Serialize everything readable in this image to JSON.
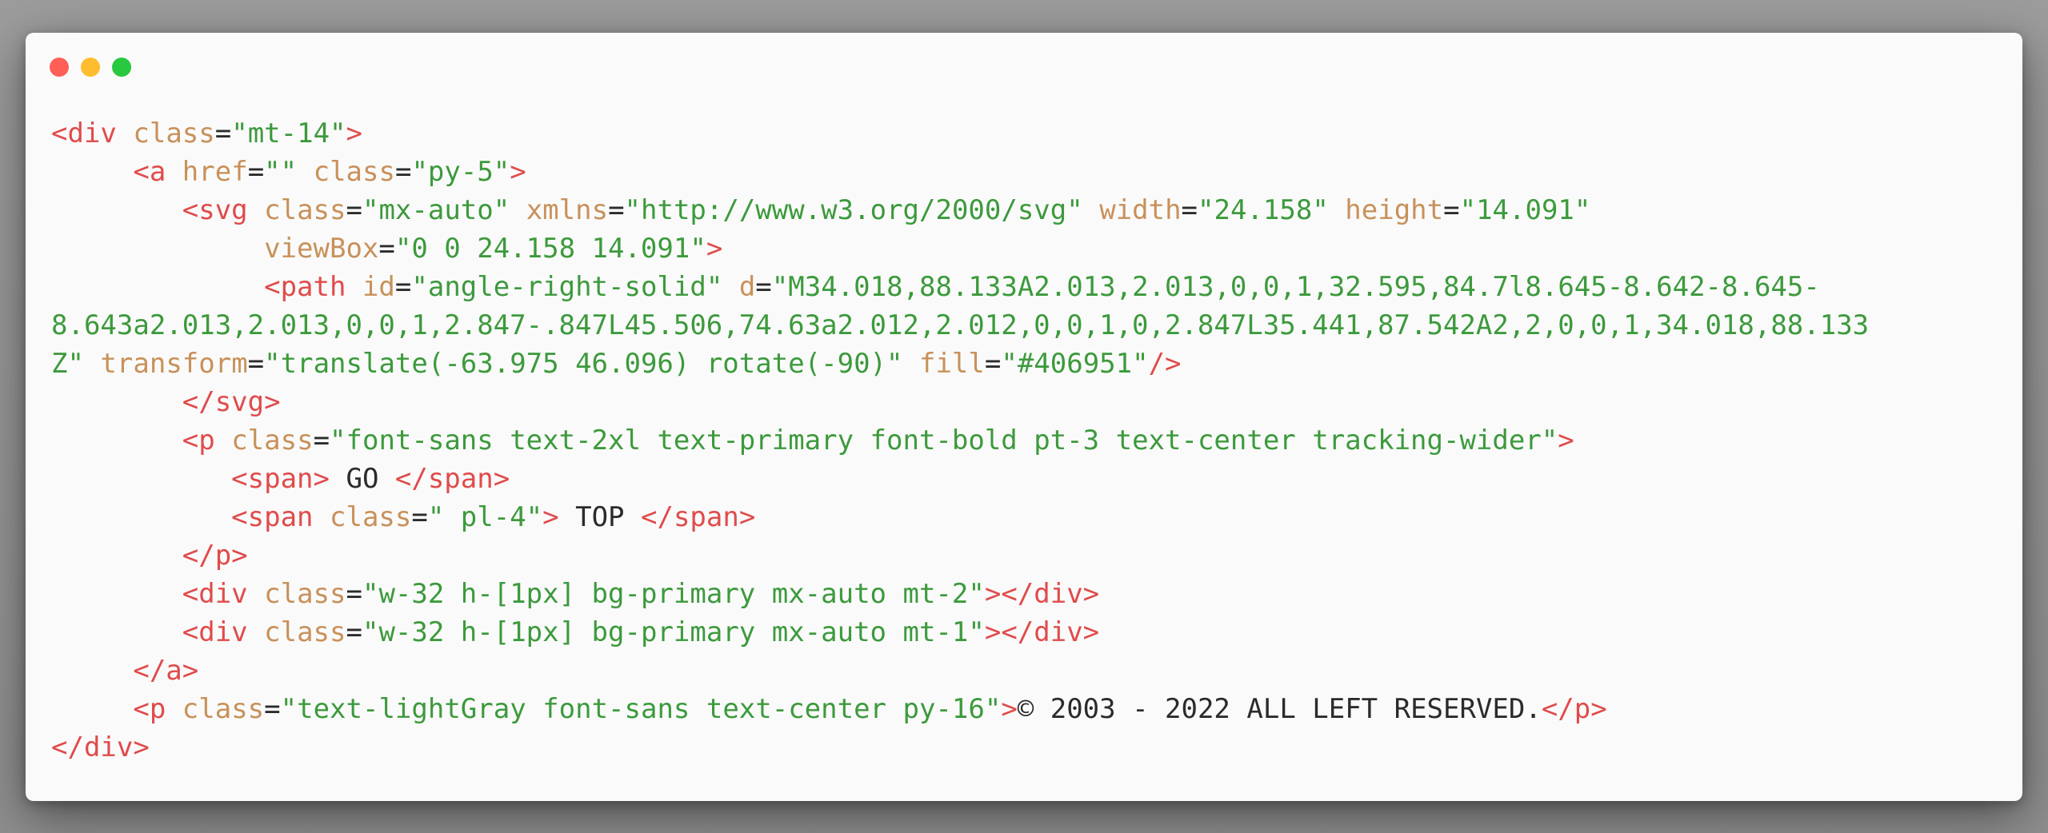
{
  "window": {
    "controls": {
      "close_color": "#ff5f57",
      "minimize_color": "#febc2e",
      "maximize_color": "#28c840"
    }
  },
  "theme": {
    "tag_color": "#e04b4b",
    "attr_color": "#c8915a",
    "string_color": "#3c9a3c",
    "text_color": "#2b2b2b",
    "background": "#fafafa"
  },
  "code_lines": [
    [
      [
        "t",
        "<div"
      ],
      [
        "p",
        " "
      ],
      [
        "a",
        "class"
      ],
      [
        "p",
        "="
      ],
      [
        "v",
        "\"mt-14\""
      ],
      [
        "t",
        ">"
      ]
    ],
    [
      [
        "p",
        "     "
      ],
      [
        "t",
        "<a"
      ],
      [
        "p",
        " "
      ],
      [
        "a",
        "href"
      ],
      [
        "p",
        "="
      ],
      [
        "v",
        "\"\""
      ],
      [
        "p",
        " "
      ],
      [
        "a",
        "class"
      ],
      [
        "p",
        "="
      ],
      [
        "v",
        "\"py-5\""
      ],
      [
        "t",
        ">"
      ]
    ],
    [
      [
        "p",
        "        "
      ],
      [
        "t",
        "<svg"
      ],
      [
        "p",
        " "
      ],
      [
        "a",
        "class"
      ],
      [
        "p",
        "="
      ],
      [
        "v",
        "\"mx-auto\""
      ],
      [
        "p",
        " "
      ],
      [
        "a",
        "xmlns"
      ],
      [
        "p",
        "="
      ],
      [
        "v",
        "\"http://www.w3.org/2000/svg\""
      ],
      [
        "p",
        " "
      ],
      [
        "a",
        "width"
      ],
      [
        "p",
        "="
      ],
      [
        "v",
        "\"24.158\""
      ],
      [
        "p",
        " "
      ],
      [
        "a",
        "height"
      ],
      [
        "p",
        "="
      ],
      [
        "v",
        "\"14.091\""
      ]
    ],
    [
      [
        "p",
        "             "
      ],
      [
        "a",
        "viewBox"
      ],
      [
        "p",
        "="
      ],
      [
        "v",
        "\"0 0 24.158 14.091\""
      ],
      [
        "t",
        ">"
      ]
    ],
    [
      [
        "p",
        "             "
      ],
      [
        "t",
        "<path"
      ],
      [
        "p",
        " "
      ],
      [
        "a",
        "id"
      ],
      [
        "p",
        "="
      ],
      [
        "v",
        "\"angle-right-solid\""
      ],
      [
        "p",
        " "
      ],
      [
        "a",
        "d"
      ],
      [
        "p",
        "="
      ],
      [
        "v",
        "\"M34.018,88.133A2.013,2.013,0,0,1,32.595,84.7l8.645-8.642-8.645-"
      ]
    ],
    [
      [
        "v",
        "8.643a2.013,2.013,0,0,1,2.847-.847L45.506,74.63a2.012,2.012,0,0,1,0,2.847L35.441,87.542A2,2,0,0,1,34.018,88.133"
      ]
    ],
    [
      [
        "v",
        "Z\""
      ],
      [
        "p",
        " "
      ],
      [
        "a",
        "transform"
      ],
      [
        "p",
        "="
      ],
      [
        "v",
        "\"translate(-63.975 46.096) rotate(-90)\""
      ],
      [
        "p",
        " "
      ],
      [
        "a",
        "fill"
      ],
      [
        "p",
        "="
      ],
      [
        "v",
        "\"#406951\""
      ],
      [
        "t",
        "/>"
      ]
    ],
    [
      [
        "p",
        "        "
      ],
      [
        "t",
        "</svg>"
      ]
    ],
    [
      [
        "p",
        "        "
      ],
      [
        "t",
        "<p"
      ],
      [
        "p",
        " "
      ],
      [
        "a",
        "class"
      ],
      [
        "p",
        "="
      ],
      [
        "v",
        "\"font-sans text-2xl text-primary font-bold pt-3 text-center tracking-wider\""
      ],
      [
        "t",
        ">"
      ]
    ],
    [
      [
        "p",
        "           "
      ],
      [
        "t",
        "<span>"
      ],
      [
        "p",
        " GO "
      ],
      [
        "t",
        "</span>"
      ]
    ],
    [
      [
        "p",
        "           "
      ],
      [
        "t",
        "<span"
      ],
      [
        "p",
        " "
      ],
      [
        "a",
        "class"
      ],
      [
        "p",
        "="
      ],
      [
        "v",
        "\" pl-4\""
      ],
      [
        "t",
        ">"
      ],
      [
        "p",
        " TOP "
      ],
      [
        "t",
        "</span>"
      ]
    ],
    [
      [
        "p",
        "        "
      ],
      [
        "t",
        "</p>"
      ]
    ],
    [
      [
        "p",
        "        "
      ],
      [
        "t",
        "<div"
      ],
      [
        "p",
        " "
      ],
      [
        "a",
        "class"
      ],
      [
        "p",
        "="
      ],
      [
        "v",
        "\"w-32 h-[1px] bg-primary mx-auto mt-2\""
      ],
      [
        "t",
        "></div>"
      ]
    ],
    [
      [
        "p",
        "        "
      ],
      [
        "t",
        "<div"
      ],
      [
        "p",
        " "
      ],
      [
        "a",
        "class"
      ],
      [
        "p",
        "="
      ],
      [
        "v",
        "\"w-32 h-[1px] bg-primary mx-auto mt-1\""
      ],
      [
        "t",
        "></div>"
      ]
    ],
    [
      [
        "p",
        "     "
      ],
      [
        "t",
        "</a>"
      ]
    ],
    [
      [
        "p",
        "     "
      ],
      [
        "t",
        "<p"
      ],
      [
        "p",
        " "
      ],
      [
        "a",
        "class"
      ],
      [
        "p",
        "="
      ],
      [
        "v",
        "\"text-lightGray font-sans text-center py-16\""
      ],
      [
        "t",
        ">"
      ],
      [
        "p",
        "© 2003 - 2022 ALL LEFT RESERVED."
      ],
      [
        "t",
        "</p>"
      ]
    ],
    [
      [
        "t",
        "</div>"
      ]
    ]
  ]
}
